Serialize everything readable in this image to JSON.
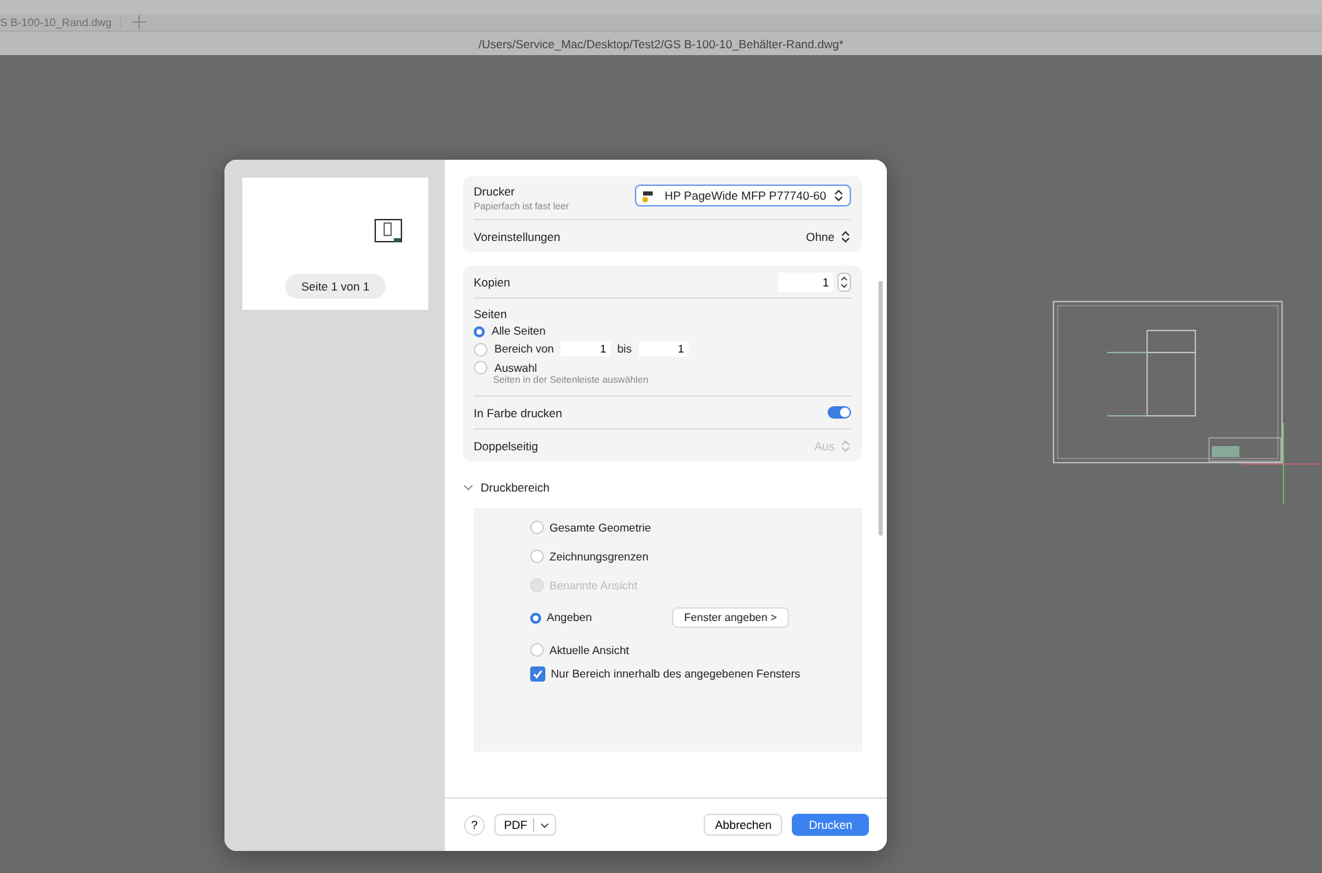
{
  "app": {
    "tab": "S B-100-10_Rand.dwg",
    "path": "/Users/Service_Mac/Desktop/Test2/GS B-100-10_Behälter-Rand.dwg*"
  },
  "preview": {
    "page_label": "Seite 1 von 1"
  },
  "printer": {
    "label": "Drucker",
    "value": "HP PageWide MFP P77740-60",
    "note": "Papierfach ist fast leer"
  },
  "presets": {
    "label": "Voreinstellungen",
    "value": "Ohne"
  },
  "copies": {
    "label": "Kopien",
    "value": "1"
  },
  "pages": {
    "label": "Seiten",
    "options": [
      {
        "label": "Alle Seiten",
        "selected": true
      },
      {
        "label": "Bereich von",
        "selected": false,
        "from": "1",
        "to_label": "bis",
        "to": "1"
      },
      {
        "label": "Auswahl",
        "selected": false,
        "note": "Seiten in der Seitenleiste auswählen"
      }
    ]
  },
  "color": {
    "label": "In Farbe drucken",
    "on": true
  },
  "duplex": {
    "label": "Doppelseitig",
    "value": "Aus",
    "disabled": true
  },
  "print_area": {
    "title": "Druckbereich",
    "expanded": true,
    "options": [
      {
        "label": "Gesamte Geometrie",
        "selected": false,
        "disabled": false
      },
      {
        "label": "Zeichnungsgrenzen",
        "selected": false,
        "disabled": false
      },
      {
        "label": "Benannte Ansicht",
        "selected": false,
        "disabled": true
      },
      {
        "label": "Angeben",
        "selected": true,
        "disabled": false,
        "button": "Fenster angeben >"
      },
      {
        "label": "Aktuelle Ansicht",
        "selected": false,
        "disabled": false
      }
    ],
    "only_window": {
      "label": "Nur Bereich innerhalb des angegebenen Fensters",
      "checked": true
    }
  },
  "footer": {
    "help": "?",
    "pdf": "PDF",
    "cancel": "Abbrechen",
    "print": "Drucken"
  }
}
